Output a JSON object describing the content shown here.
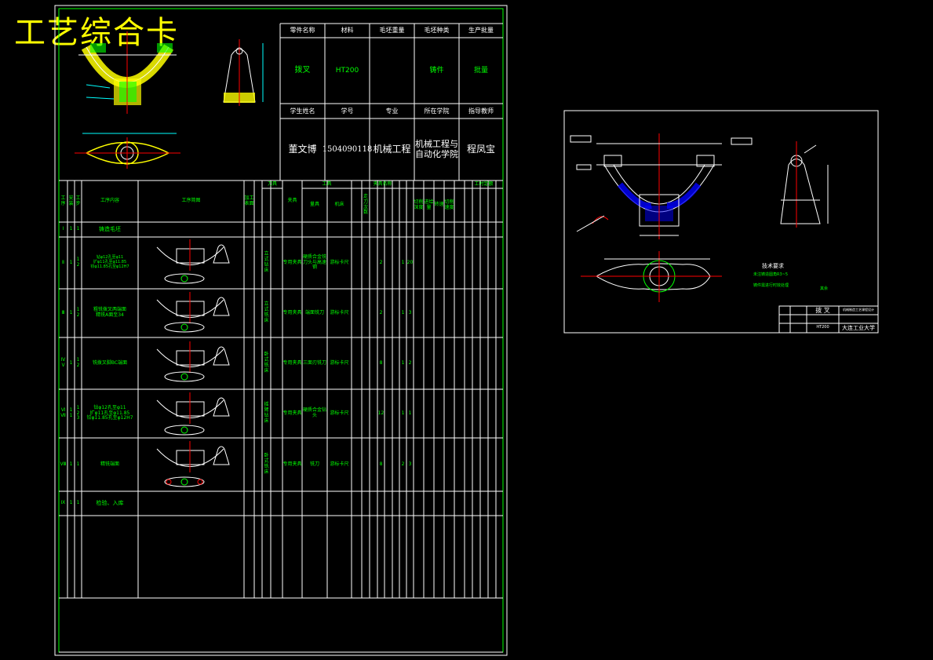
{
  "banner": {
    "title": "工艺综合卡"
  },
  "info_table": {
    "headers_row1": [
      "零件名称",
      "材料",
      "毛坯重量",
      "毛坯种类",
      "生产批量"
    ],
    "values_row1": [
      "拨叉",
      "HT200",
      "",
      "铸件",
      "批量"
    ],
    "headers_row2": [
      "学生姓名",
      "学号",
      "专业",
      "所在学院",
      "指导教师"
    ],
    "values_row2": [
      "董文博",
      "1504090118",
      "机械工程",
      "机械工程与\n自动化学院",
      "程凤宝"
    ]
  },
  "process_table": {
    "headers": [
      "工序",
      "安装",
      "工步",
      "工序内容",
      "工序简图",
      "加工表面",
      "刀具",
      "夹具",
      "量具",
      "机床",
      "工具",
      "夹具名称",
      "走刀次数",
      "切削深度",
      "进给量",
      "转速",
      "切削速度",
      "工时定额"
    ],
    "rows": [
      {
        "op": "Ⅰ",
        "install": "1",
        "step": "1",
        "content": "铸造毛坯",
        "image": false
      },
      {
        "op": "Ⅱ",
        "install": "1",
        "step": "1\n2",
        "content": "钻φ12孔至φ11\n扩φ11孔至φ11.85\n铰φ11.85孔至φ12H7",
        "image": true,
        "machine": "立式钻床",
        "fixture": "专用夹具",
        "tool": "硬质合金铣刀头与高速钢",
        "measure": "游标卡尺",
        "nums": [
          "2",
          "1",
          "20"
        ]
      },
      {
        "op": "Ⅲ",
        "install": "1",
        "step": "1\n2",
        "content": "粗铣拨叉两端面\n精铣A面至34",
        "image": true,
        "machine": "立式铣床",
        "fixture": "专用夹具",
        "tool": "端面铣刀",
        "measure": "游标卡尺",
        "nums": [
          "2",
          "1",
          "3"
        ]
      },
      {
        "op": "Ⅳ\nⅤ",
        "install": "1",
        "step": "1\n2",
        "content": "铣拨叉脚BC端面",
        "image": true,
        "machine": "卧式铣床",
        "fixture": "专用夹具",
        "tool": "三面刃铣刀",
        "measure": "游标卡尺",
        "nums": [
          "8",
          "1",
          "2"
        ]
      },
      {
        "op": "Ⅵ\nⅦ",
        "install": "1\n1",
        "step": "1\n2\n3",
        "content": "钻φ12孔至φ11\n扩φ11孔至φ11.85\n铰φ11.85孔至φ12H7",
        "image": true,
        "machine": "摇臂钻床",
        "fixture": "专用夹具",
        "tool": "硬质合金钻头",
        "measure": "游标卡尺",
        "nums": [
          "12",
          "1",
          "1"
        ]
      },
      {
        "op": "Ⅷ",
        "install": "1",
        "step": "1",
        "content": "精铣端面",
        "image": true,
        "machine": "卧式铣床",
        "fixture": "专用夹具",
        "tool": "铣刀",
        "measure": "游标卡尺",
        "nums": [
          "8",
          "2",
          "3"
        ]
      },
      {
        "op": "Ⅸ",
        "install": "1",
        "step": "1",
        "content": "检验、入库",
        "image": false
      }
    ]
  },
  "drawing": {
    "title_block": {
      "part_name": "拨 叉",
      "material": "HT200",
      "school": "大连工业大学",
      "drawing_no": "机械制造工艺课程设计"
    },
    "tech_req_title": "技术要求",
    "tech_req_lines": [
      "未注铸造圆角R3~5",
      "铸件需进行时效处理"
    ],
    "roughness": "其余"
  }
}
